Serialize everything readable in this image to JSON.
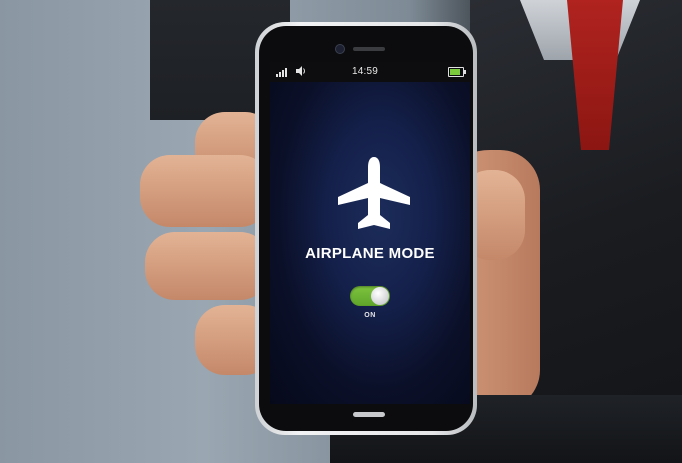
{
  "status_bar": {
    "time": "14:59",
    "signal_icon": "signal-bars-icon",
    "volume_icon": "speaker-icon",
    "battery_icon": "battery-icon",
    "battery_level": 0.8,
    "battery_color": "#7ccb3c"
  },
  "airplane_mode": {
    "icon": "airplane-icon",
    "title": "AIRPLANE MODE",
    "toggle_state_label": "ON",
    "toggle_on": true,
    "toggle_color": "#6bb432"
  }
}
